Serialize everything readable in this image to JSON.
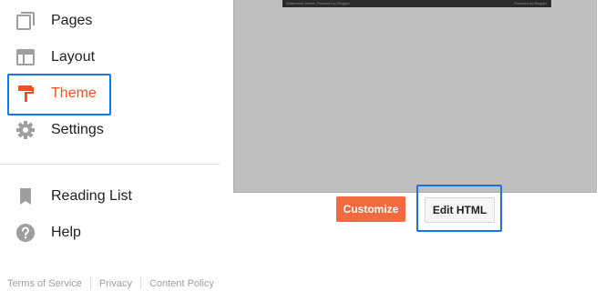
{
  "sidebar": {
    "items": [
      {
        "label": "Pages",
        "icon": "pages-icon"
      },
      {
        "label": "Layout",
        "icon": "layout-icon"
      },
      {
        "label": "Theme",
        "icon": "theme-paint-roller-icon",
        "active": true
      },
      {
        "label": "Settings",
        "icon": "gear-icon"
      }
    ],
    "secondary_items": [
      {
        "label": "Reading List",
        "icon": "bookmark-icon"
      },
      {
        "label": "Help",
        "icon": "help-icon"
      }
    ],
    "footer_links": [
      "Terms of Service",
      "Privacy",
      "Content Policy"
    ]
  },
  "preview": {
    "footer_left": "Watermark theme. Powered by Blogger.",
    "footer_right": "Powered by Blogger."
  },
  "actions": {
    "customize_label": "Customize",
    "edit_html_label": "Edit HTML"
  },
  "colors": {
    "accent": "#f4511e",
    "customize_button": "#f26a3d",
    "highlight": "#1a73e8",
    "icon_gray": "#9e9e9e"
  }
}
